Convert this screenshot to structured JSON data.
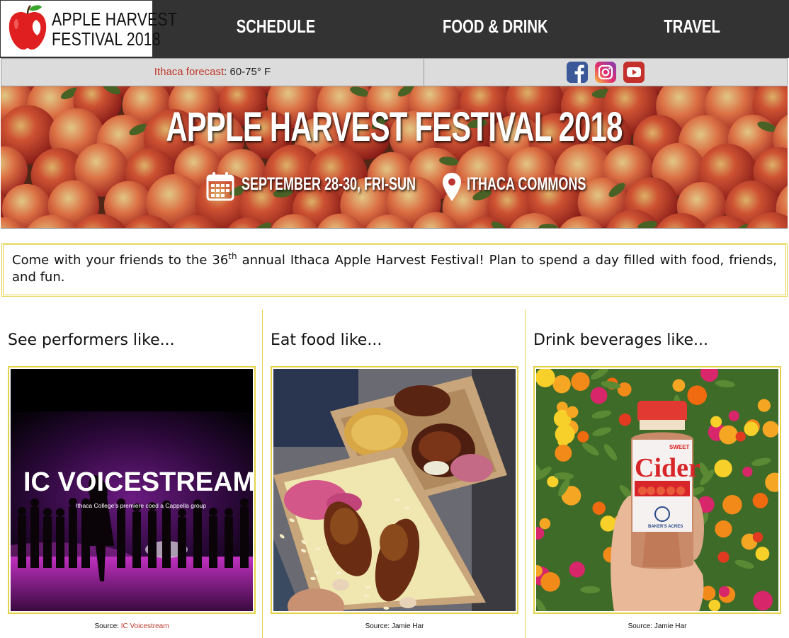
{
  "logo": {
    "line1": "APPLE HARVEST",
    "line2": "FESTIVAL 2018"
  },
  "nav": {
    "schedule": "SCHEDULE",
    "food": "FOOD & DRINK",
    "travel": "TRAVEL"
  },
  "forecast": {
    "label": "Ithaca forecast",
    "value": ": 60-75° F"
  },
  "social": {
    "facebook_icon": "facebook-icon",
    "instagram_icon": "instagram-icon",
    "youtube_icon": "youtube-icon"
  },
  "hero": {
    "title": "APPLE HARVEST FESTIVAL 2018",
    "date": "SEPTEMBER 28-30, FRI-SUN",
    "location": "ITHACA COMMONS"
  },
  "intro": {
    "before": "Come with your friends to the 36",
    "sup": "th",
    "after": " annual Ithaca Apple Harvest Festival! Plan to spend a day filled with food, friends, and fun."
  },
  "columns": [
    {
      "title": "See performers like...",
      "source_label": "Source: ",
      "source_name": "IC Voicestream",
      "photo_text": "IC VOICESTREAM",
      "photo_subtext": "Ithaca College's premiere coed a Cappella group"
    },
    {
      "title": "Eat food like...",
      "source_label": "Source: ",
      "source_name": "Jamie Har"
    },
    {
      "title": "Drink beverages like...",
      "source_label": "Source: ",
      "source_name": "Jamie Har",
      "label_sweet": "SWEET",
      "label_main": "Cider",
      "label_brand": "BAKER'S ACRES"
    }
  ],
  "colors": {
    "header_bg": "#333333",
    "accent_red": "#c0392b",
    "border_yellow": "#e5d24a",
    "infobar_bg": "#dcdcdc"
  }
}
